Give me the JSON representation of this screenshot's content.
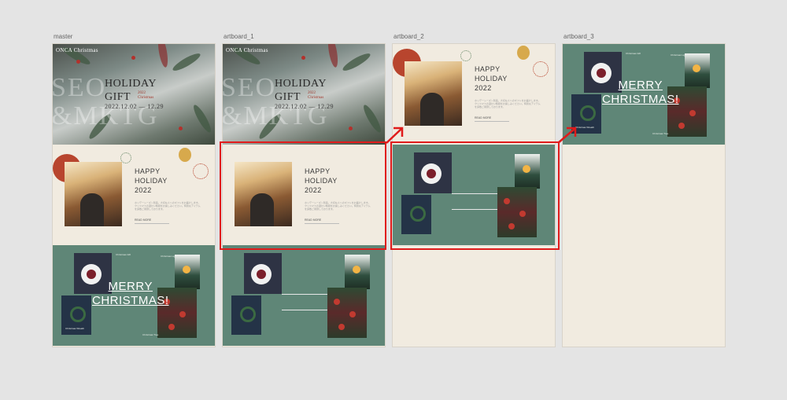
{
  "artboards": [
    {
      "label": "master"
    },
    {
      "label": "artboard_1"
    },
    {
      "label": "artboard_2"
    },
    {
      "label": "artboard_3"
    }
  ],
  "hero": {
    "logo": "ONCA Christmas",
    "title_line1": "HOLIDAY",
    "title_line2": "GIFT",
    "sub_line1": "2022",
    "sub_line2": "Christmas",
    "date": "2022.12.02 — 12.29",
    "big_line1": "SEO",
    "big_line2": "&MKTG"
  },
  "holiday": {
    "title_line1": "HAPPY",
    "title_line2": "HOLIDAY",
    "title_line3": "2022",
    "body": "ホリデーシーズン到来。大切な人へのギフトをお届けします。クリスマスの温かい時間をお楽しみください。特別なアイテムを多数ご用意しております。",
    "read_more": "READ MORE"
  },
  "merry": {
    "line1": "MERRY",
    "line2": "CHRISTMAS!",
    "note_a": "Christmas Gift",
    "note_b": "Christmas Light",
    "note_c": "Christmas Tree",
    "note_d": "Christmas Wreath"
  },
  "colors": {
    "accent_highlight": "#e01b1b",
    "cream": "#f1ebe0",
    "green": "#5f8677",
    "ornament_red": "#b8452e"
  }
}
